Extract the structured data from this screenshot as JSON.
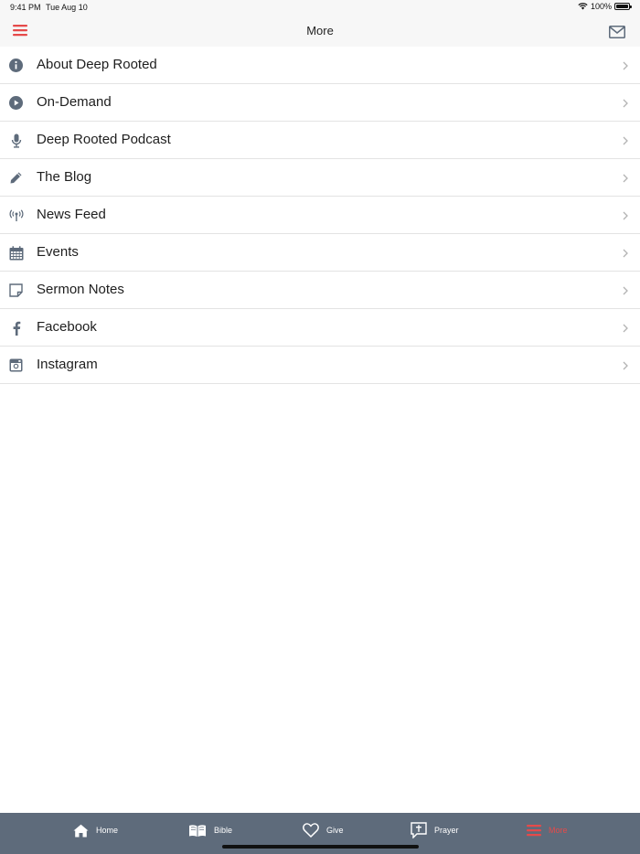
{
  "status": {
    "time": "9:41 PM",
    "date": "Tue Aug 10",
    "battery": "100%"
  },
  "nav": {
    "title": "More"
  },
  "items": [
    {
      "label": "About Deep Rooted",
      "icon": "info-icon"
    },
    {
      "label": "On-Demand",
      "icon": "play-icon"
    },
    {
      "label": "Deep Rooted Podcast",
      "icon": "microphone-icon"
    },
    {
      "label": "The Blog",
      "icon": "pencil-icon"
    },
    {
      "label": "News Feed",
      "icon": "broadcast-icon"
    },
    {
      "label": "Events",
      "icon": "calendar-icon"
    },
    {
      "label": "Sermon Notes",
      "icon": "note-icon"
    },
    {
      "label": "Facebook",
      "icon": "facebook-icon"
    },
    {
      "label": "Instagram",
      "icon": "instagram-icon"
    }
  ],
  "tabs": [
    {
      "label": "Home",
      "icon": "home-icon"
    },
    {
      "label": "Bible",
      "icon": "book-icon"
    },
    {
      "label": "Give",
      "icon": "heart-icon"
    },
    {
      "label": "Prayer",
      "icon": "prayer-icon"
    },
    {
      "label": "More",
      "icon": "menu-icon",
      "active": true
    }
  ],
  "colors": {
    "accent": "#e54a4a",
    "tab_bar": "#5e6b7b",
    "icon": "#5e6b7b"
  }
}
